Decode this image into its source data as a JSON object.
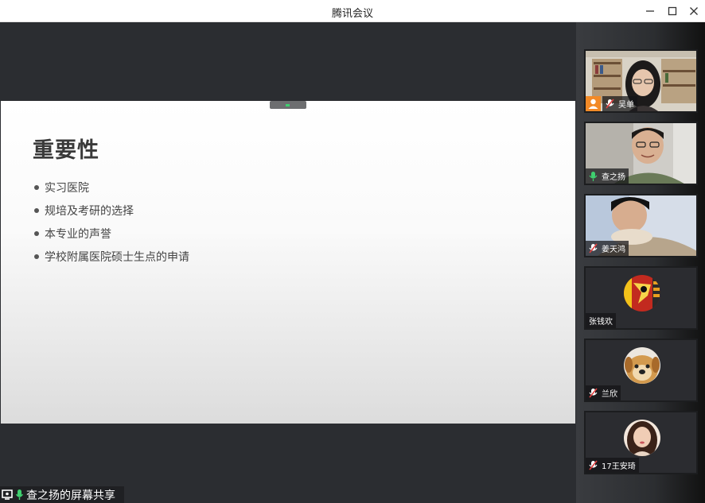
{
  "window": {
    "title": "腾讯会议"
  },
  "slide": {
    "title": "重要性",
    "bullets": [
      "实习医院",
      "规培及考研的选择",
      "本专业的声誉",
      "学校附属医院硕士生点的申请"
    ]
  },
  "share": {
    "label": "查之扬的屏幕共享"
  },
  "participants": [
    {
      "name": "吴单",
      "mic": "muted",
      "type": "video"
    },
    {
      "name": "查之扬",
      "mic": "active",
      "type": "video"
    },
    {
      "name": "姜天鸿",
      "mic": "muted",
      "type": "video"
    },
    {
      "name": "张钱欢",
      "mic": "none",
      "type": "avatar"
    },
    {
      "name": "兰欣",
      "mic": "muted",
      "type": "avatar"
    },
    {
      "name": "17王安琦",
      "mic": "muted",
      "type": "avatar"
    }
  ],
  "colors": {
    "accent_green": "#3fcf6f",
    "mute_red": "#e04040",
    "orange": "#f28a27"
  }
}
